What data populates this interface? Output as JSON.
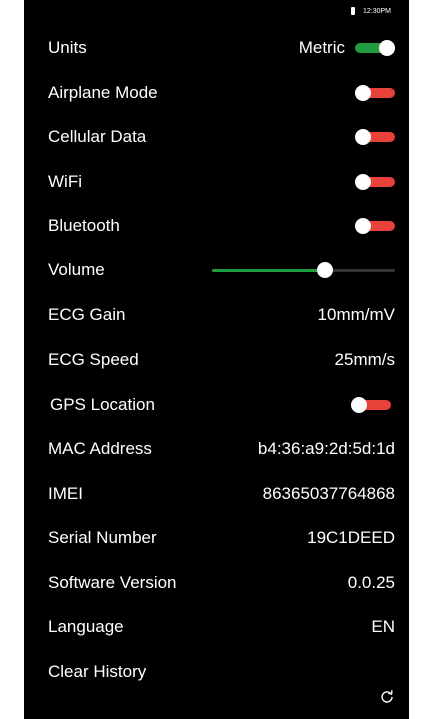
{
  "status_bar": {
    "time": "12:30PM"
  },
  "colors": {
    "toggle_on": "#1f9d3f",
    "toggle_off": "#e8423a",
    "slider_fill": "#1f9d3f"
  },
  "settings": {
    "units": {
      "label": "Units",
      "value": "Metric",
      "on": true
    },
    "airplane": {
      "label": "Airplane Mode",
      "on": false
    },
    "cellular": {
      "label": "Cellular Data",
      "on": false
    },
    "wifi": {
      "label": "WiFi",
      "on": false
    },
    "bluetooth": {
      "label": "Bluetooth",
      "on": false
    },
    "volume": {
      "label": "Volume",
      "level": 0.62
    },
    "ecg_gain": {
      "label": "ECG Gain",
      "value": "10mm/mV"
    },
    "ecg_speed": {
      "label": "ECG Speed",
      "value": "25mm/s"
    },
    "gps": {
      "label": "GPS Location",
      "on": false
    },
    "mac": {
      "label": "MAC Address",
      "value": "b4:36:a9:2d:5d:1d"
    },
    "imei": {
      "label": "IMEI",
      "value": "86365037764868"
    },
    "serial": {
      "label": "Serial Number",
      "value": "19C1DEED"
    },
    "software": {
      "label": "Software Version",
      "value": "0.0.25"
    },
    "language": {
      "label": "Language",
      "value": "EN"
    },
    "clear_history": {
      "label": "Clear History"
    }
  },
  "icons": {
    "battery": "battery-icon",
    "refresh": "refresh-icon"
  }
}
